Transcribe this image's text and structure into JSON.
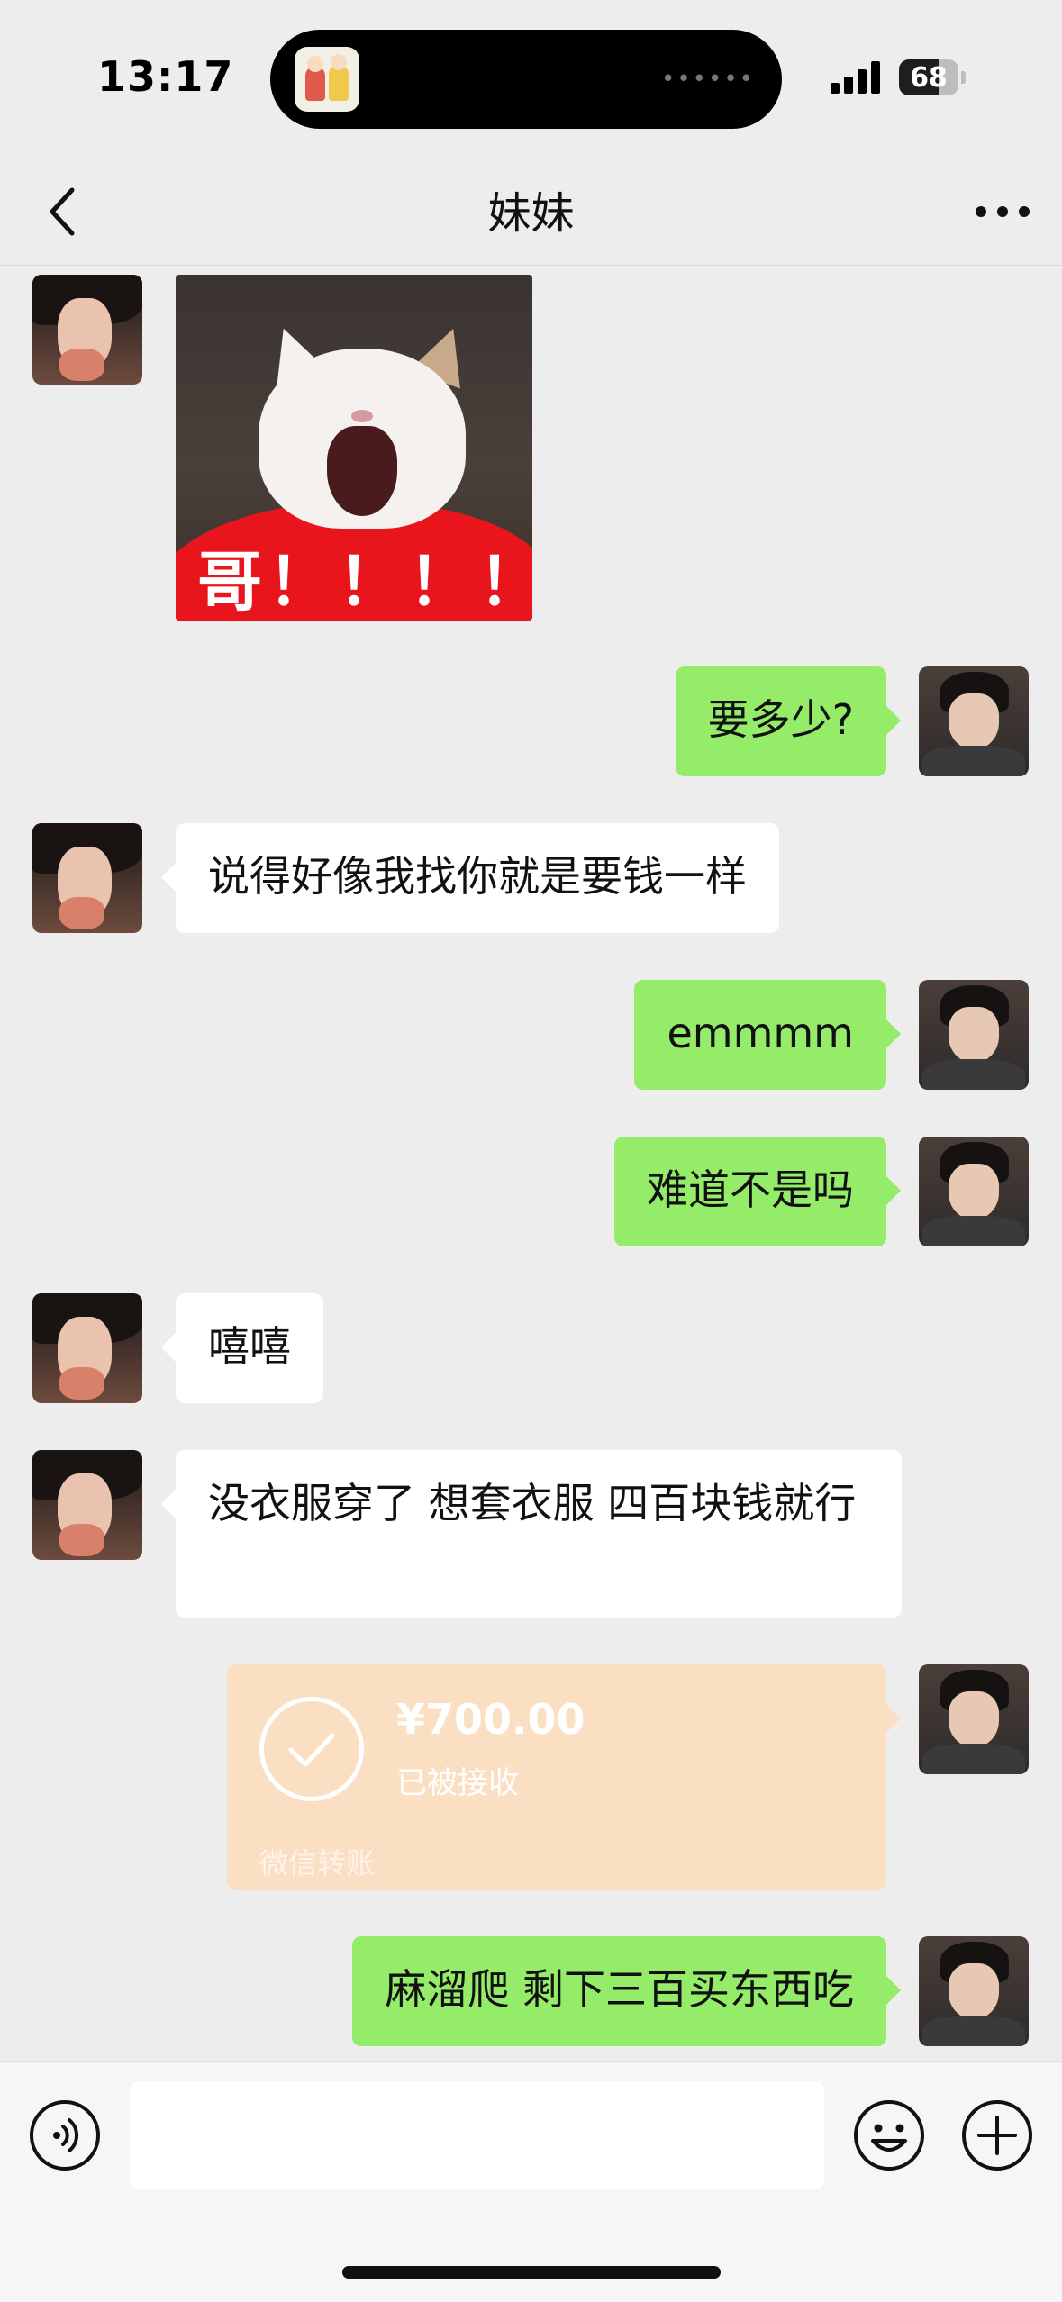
{
  "status_bar": {
    "time": "13:17",
    "battery_level": "68",
    "dynamic_island_dots": "••••••"
  },
  "nav": {
    "title": "妹妹",
    "back_icon": "chevron-left-icon",
    "more_icon": "more-dots-icon"
  },
  "messages": [
    {
      "from": "other",
      "type": "sticker",
      "caption": "哥！！！！"
    },
    {
      "from": "me",
      "type": "text",
      "text": "要多少?"
    },
    {
      "from": "other",
      "type": "text",
      "text": "说得好像我找你就是要钱一样"
    },
    {
      "from": "me",
      "type": "text",
      "text": "emmmm"
    },
    {
      "from": "me",
      "type": "text",
      "text": "难道不是吗"
    },
    {
      "from": "other",
      "type": "text",
      "text": "嘻嘻"
    },
    {
      "from": "other",
      "type": "text",
      "text": "没衣服穿了 想套衣服 四百块钱就行"
    },
    {
      "from": "me",
      "type": "transfer",
      "amount": "¥700.00",
      "status": "已被接收",
      "footer": "微信转账"
    },
    {
      "from": "me",
      "type": "text",
      "text": "麻溜爬 剩下三百买东西吃"
    }
  ],
  "input_bar": {
    "placeholder": "",
    "voice_icon": "voice-icon",
    "emoji_icon": "emoji-icon",
    "plus_icon": "plus-circle-icon"
  },
  "colors": {
    "background": "#ededed",
    "bubble_out": "#95ec69",
    "bubble_in": "#ffffff",
    "transfer_card": "#fbdfc3"
  }
}
